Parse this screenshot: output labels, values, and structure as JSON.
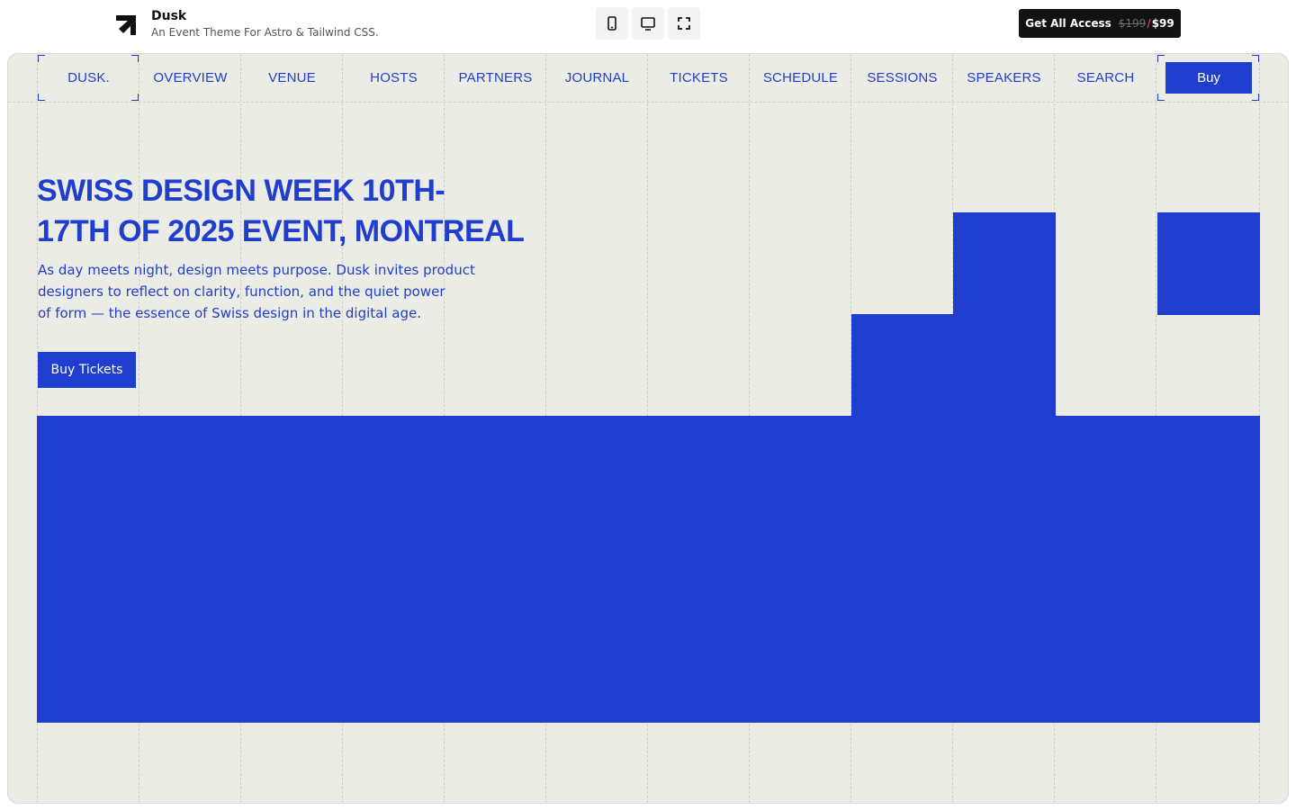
{
  "topbar": {
    "brand_name": "Dusk",
    "brand_tagline": "An Event Theme For Astro & Tailwind CSS.",
    "devices": [
      {
        "icon": "mobile-icon"
      },
      {
        "icon": "desktop-icon"
      },
      {
        "icon": "fullscreen-icon"
      }
    ],
    "access": {
      "label": "Get All Access",
      "old_price": "$199",
      "separator": "/",
      "new_price": "$99"
    }
  },
  "nav": {
    "logo": "DUSK.",
    "items": [
      "OVERVIEW",
      "VENUE",
      "HOSTS",
      "PARTNERS",
      "JOURNAL",
      "TICKETS",
      "SCHEDULE",
      "SESSIONS",
      "SPEAKERS",
      "SEARCH"
    ],
    "buy_label": "Buy"
  },
  "hero": {
    "title_line1": "Swiss Design Week 10th-",
    "title_line2": "17th of 2025 Event, Montreal",
    "subtitle_line1": "As day meets night, design meets purpose. Dusk invites product",
    "subtitle_line2": "designers to reflect on clarity, function, and the quiet power",
    "subtitle_line3": "of form — the essence of Swiss design in the digital age.",
    "cta_label": "Buy Tickets"
  },
  "colors": {
    "accent": "#1f3ecd",
    "background": "#ecece7",
    "dark": "#111214",
    "price_slash": "#e4452f"
  }
}
